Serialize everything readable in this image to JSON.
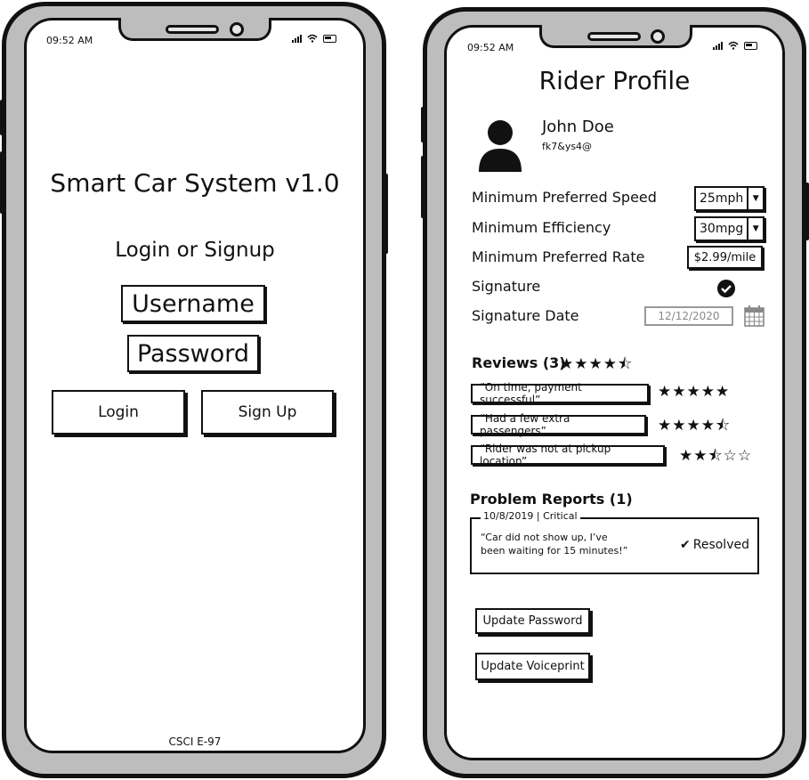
{
  "left": {
    "status": {
      "time": "09:52 AM"
    },
    "title": "Smart Car System v1.0",
    "subtitle": "Login or Signup",
    "username_placeholder": "Username",
    "password_placeholder": "Password",
    "login_label": "Login",
    "signup_label": "Sign Up",
    "footer": "CSCI E-97"
  },
  "right": {
    "status": {
      "time": "09:52 AM"
    },
    "title": "Rider Profile",
    "user": {
      "name": "John Doe",
      "id": "fk7&ys4@"
    },
    "prefs": {
      "speed_label": "Minimum Preferred Speed",
      "speed_value": "25mph",
      "efficiency_label": "Minimum Efficiency",
      "efficiency_value": "30mpg",
      "rate_label": "Minimum Preferred Rate",
      "rate_value": "$2.99/mile",
      "signature_label": "Signature",
      "signature_date_label": "Signature Date",
      "signature_date_value": "12/12/2020"
    },
    "reviews": {
      "heading": "Reviews (3)",
      "overall_rating": 4.5,
      "items": [
        {
          "text": "“On time, payment successful”",
          "rating": 5
        },
        {
          "text": "“Had a few extra passengers”",
          "rating": 4.5
        },
        {
          "text": "“Rider was not at pickup location”",
          "rating": 2.5
        }
      ]
    },
    "problems": {
      "heading": "Problem Reports (1)",
      "legend": "10/8/2019 | Critical",
      "line1": "“Car did not show up, I’ve",
      "line2": "been waiting for 15 minutes!”",
      "status": "Resolved"
    },
    "buttons": {
      "update_password": "Update Password",
      "update_voiceprint": "Update Voiceprint"
    }
  }
}
